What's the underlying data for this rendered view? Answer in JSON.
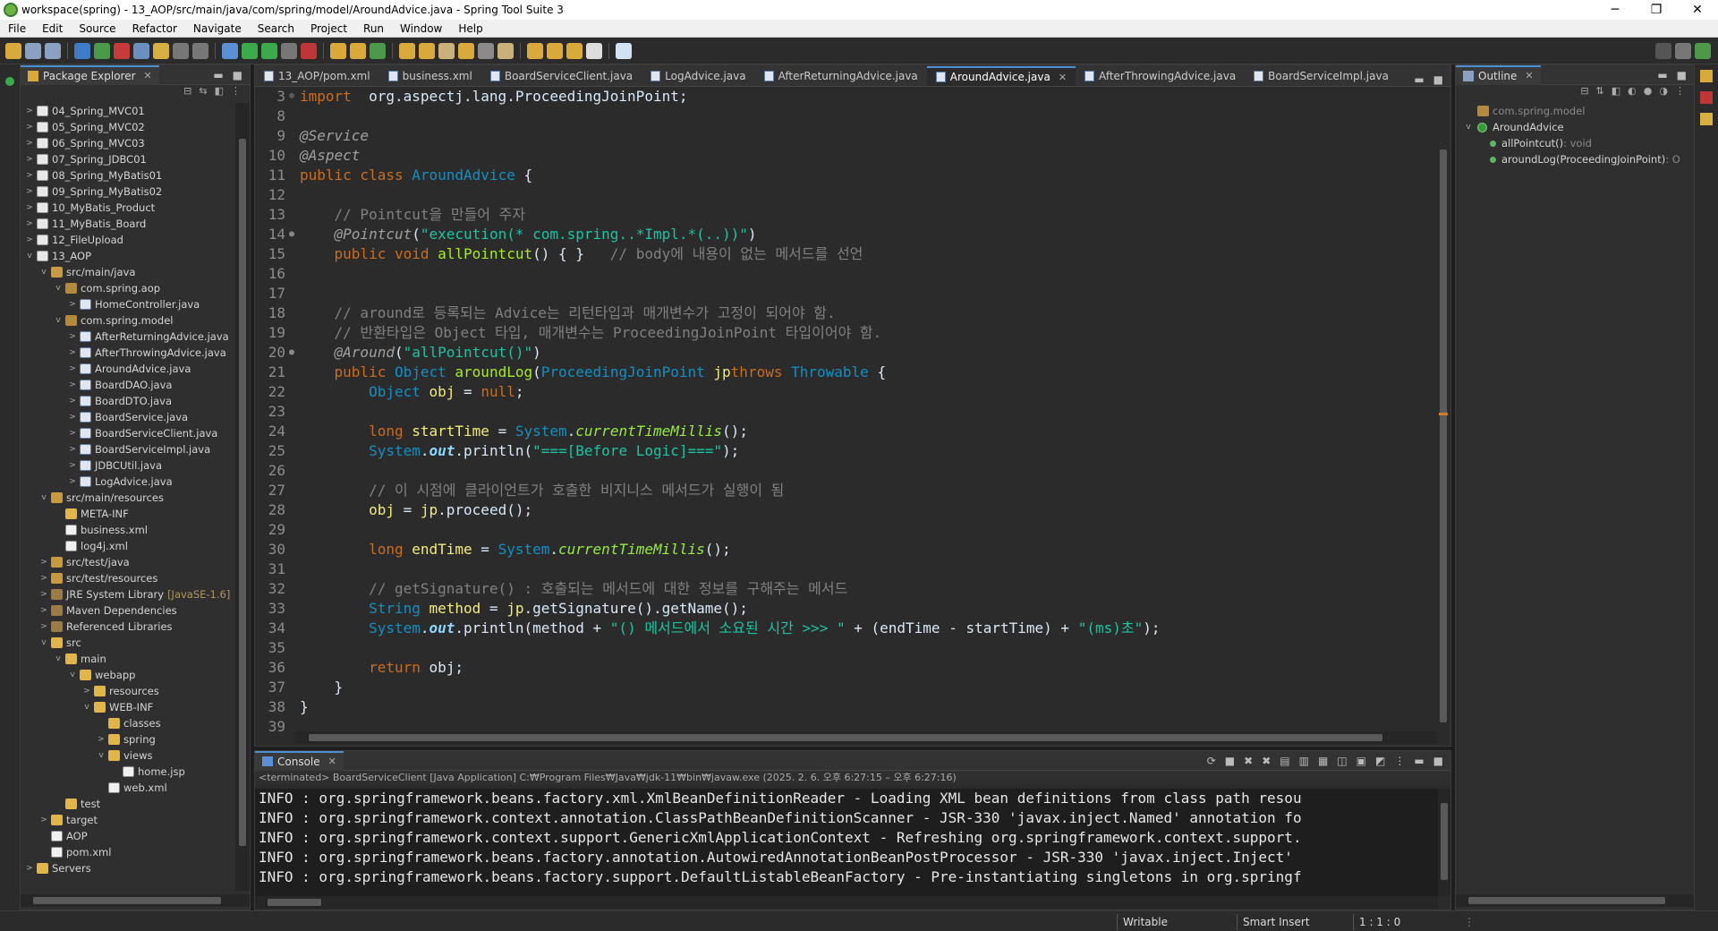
{
  "window": {
    "title": "workspace(spring) - 13_AOP/src/main/java/com/spring/model/AroundAdvice.java - Spring Tool Suite 3",
    "minimize": "─",
    "maximize": "❐",
    "close": "✕"
  },
  "menu": [
    "File",
    "Edit",
    "Source",
    "Refactor",
    "Navigate",
    "Search",
    "Project",
    "Run",
    "Window",
    "Help"
  ],
  "package_explorer": {
    "title": "Package Explorer",
    "tree": [
      {
        "depth": 0,
        "twisty": ">",
        "icon": "proj",
        "label": "04_Spring_MVC01"
      },
      {
        "depth": 0,
        "twisty": ">",
        "icon": "proj",
        "label": "05_Spring_MVC02"
      },
      {
        "depth": 0,
        "twisty": ">",
        "icon": "proj",
        "label": "06_Spring_MVC03"
      },
      {
        "depth": 0,
        "twisty": ">",
        "icon": "proj",
        "label": "07_Spring_JDBC01"
      },
      {
        "depth": 0,
        "twisty": ">",
        "icon": "proj",
        "label": "08_Spring_MyBatis01"
      },
      {
        "depth": 0,
        "twisty": ">",
        "icon": "proj",
        "label": "09_Spring_MyBatis02"
      },
      {
        "depth": 0,
        "twisty": ">",
        "icon": "proj",
        "label": "10_MyBatis_Product"
      },
      {
        "depth": 0,
        "twisty": ">",
        "icon": "proj",
        "label": "11_MyBatis_Board"
      },
      {
        "depth": 0,
        "twisty": ">",
        "icon": "proj",
        "label": "12_FileUpload"
      },
      {
        "depth": 0,
        "twisty": "v",
        "icon": "proj",
        "label": "13_AOP"
      },
      {
        "depth": 1,
        "twisty": "v",
        "icon": "src",
        "label": "src/main/java"
      },
      {
        "depth": 2,
        "twisty": "v",
        "icon": "pkgi",
        "label": "com.spring.aop"
      },
      {
        "depth": 3,
        "twisty": ">",
        "icon": "java",
        "label": "HomeController.java"
      },
      {
        "depth": 2,
        "twisty": "v",
        "icon": "pkgi",
        "label": "com.spring.model"
      },
      {
        "depth": 3,
        "twisty": ">",
        "icon": "java",
        "label": "AfterReturningAdvice.java"
      },
      {
        "depth": 3,
        "twisty": ">",
        "icon": "java",
        "label": "AfterThrowingAdvice.java"
      },
      {
        "depth": 3,
        "twisty": ">",
        "icon": "java",
        "label": "AroundAdvice.java"
      },
      {
        "depth": 3,
        "twisty": ">",
        "icon": "java",
        "label": "BoardDAO.java"
      },
      {
        "depth": 3,
        "twisty": ">",
        "icon": "java",
        "label": "BoardDTO.java"
      },
      {
        "depth": 3,
        "twisty": ">",
        "icon": "java",
        "label": "BoardService.java"
      },
      {
        "depth": 3,
        "twisty": ">",
        "icon": "java",
        "label": "BoardServiceClient.java"
      },
      {
        "depth": 3,
        "twisty": ">",
        "icon": "java",
        "label": "BoardServiceImpl.java"
      },
      {
        "depth": 3,
        "twisty": ">",
        "icon": "java",
        "label": "JDBCUtil.java"
      },
      {
        "depth": 3,
        "twisty": ">",
        "icon": "java",
        "label": "LogAdvice.java"
      },
      {
        "depth": 1,
        "twisty": "v",
        "icon": "src",
        "label": "src/main/resources"
      },
      {
        "depth": 2,
        "twisty": "",
        "icon": "folder",
        "label": "META-INF"
      },
      {
        "depth": 2,
        "twisty": "",
        "icon": "xml",
        "label": "business.xml"
      },
      {
        "depth": 2,
        "twisty": "",
        "icon": "xml",
        "label": "log4j.xml"
      },
      {
        "depth": 1,
        "twisty": ">",
        "icon": "src",
        "label": "src/test/java"
      },
      {
        "depth": 1,
        "twisty": ">",
        "icon": "src",
        "label": "src/test/resources"
      },
      {
        "depth": 1,
        "twisty": ">",
        "icon": "lib",
        "label": "JRE System Library",
        "extra": "[JavaSE-1.6]"
      },
      {
        "depth": 1,
        "twisty": ">",
        "icon": "lib",
        "label": "Maven Dependencies"
      },
      {
        "depth": 1,
        "twisty": ">",
        "icon": "lib",
        "label": "Referenced Libraries"
      },
      {
        "depth": 1,
        "twisty": "v",
        "icon": "folder",
        "label": "src"
      },
      {
        "depth": 2,
        "twisty": "v",
        "icon": "folder",
        "label": "main"
      },
      {
        "depth": 3,
        "twisty": "v",
        "icon": "folder",
        "label": "webapp"
      },
      {
        "depth": 4,
        "twisty": ">",
        "icon": "folder",
        "label": "resources"
      },
      {
        "depth": 4,
        "twisty": "v",
        "icon": "folder",
        "label": "WEB-INF"
      },
      {
        "depth": 5,
        "twisty": "",
        "icon": "folder",
        "label": "classes"
      },
      {
        "depth": 5,
        "twisty": ">",
        "icon": "folder",
        "label": "spring"
      },
      {
        "depth": 5,
        "twisty": "v",
        "icon": "folder",
        "label": "views"
      },
      {
        "depth": 6,
        "twisty": "",
        "icon": "xml",
        "label": "home.jsp"
      },
      {
        "depth": 5,
        "twisty": "",
        "icon": "xml",
        "label": "web.xml"
      },
      {
        "depth": 2,
        "twisty": "",
        "icon": "folder",
        "label": "test"
      },
      {
        "depth": 1,
        "twisty": ">",
        "icon": "folder",
        "label": "target"
      },
      {
        "depth": 1,
        "twisty": "",
        "icon": "xml",
        "label": "AOP"
      },
      {
        "depth": 1,
        "twisty": "",
        "icon": "xml",
        "label": "pom.xml"
      },
      {
        "depth": 0,
        "twisty": ">",
        "icon": "folder",
        "label": "Servers"
      }
    ]
  },
  "editor": {
    "tabs": [
      {
        "label": "13_AOP/pom.xml",
        "active": false
      },
      {
        "label": "business.xml",
        "active": false
      },
      {
        "label": "BoardServiceClient.java",
        "active": false
      },
      {
        "label": "LogAdvice.java",
        "active": false
      },
      {
        "label": "AfterReturningAdvice.java",
        "active": false
      },
      {
        "label": "AroundAdvice.java",
        "active": true
      },
      {
        "label": "AfterThrowingAdvice.java",
        "active": false
      },
      {
        "label": "BoardServiceImpl.java",
        "active": false
      }
    ],
    "lines": [
      {
        "n": "3",
        "m": "⊕",
        "tokens": [
          [
            "k",
            "import"
          ],
          [
            "",
            "  org.aspectj.lang.ProceedingJoinPoint;"
          ]
        ]
      },
      {
        "n": "8",
        "m": "",
        "tokens": []
      },
      {
        "n": "9",
        "m": "",
        "tokens": [
          [
            "ann",
            "@Service"
          ]
        ]
      },
      {
        "n": "10",
        "m": "",
        "tokens": [
          [
            "ann",
            "@Aspect"
          ]
        ]
      },
      {
        "n": "11",
        "m": "",
        "tokens": [
          [
            "k",
            "public class "
          ],
          [
            "t",
            "AroundAdvice"
          ],
          [
            "",
            " {"
          ]
        ]
      },
      {
        "n": "12",
        "m": "",
        "tokens": []
      },
      {
        "n": "13",
        "m": "",
        "tokens": [
          [
            "com",
            "    // Pointcut을 만들어 주자"
          ]
        ]
      },
      {
        "n": "14",
        "m": "●",
        "tokens": [
          [
            "ann",
            "    @Pointcut"
          ],
          [
            "",
            "("
          ],
          [
            "str",
            "\"execution(* com.spring..*Impl.*(..))\""
          ],
          [
            "",
            ")"
          ]
        ]
      },
      {
        "n": "15",
        "m": "",
        "tokens": [
          [
            "k",
            "    public void "
          ],
          [
            "fn",
            "allPointcut"
          ],
          [
            "",
            "() { }   "
          ],
          [
            "com",
            "// body에 내용이 없는 메서드를 선언"
          ]
        ]
      },
      {
        "n": "16",
        "m": "",
        "tokens": []
      },
      {
        "n": "17",
        "m": "",
        "tokens": []
      },
      {
        "n": "18",
        "m": "",
        "tokens": [
          [
            "com",
            "    // around로 등록되는 Advice는 리턴타입과 매개변수가 고정이 되어야 함."
          ]
        ]
      },
      {
        "n": "19",
        "m": "",
        "tokens": [
          [
            "com",
            "    // 반환타입은 Object 타입, 매개변수는 ProceedingJoinPoint 타입이어야 함."
          ]
        ]
      },
      {
        "n": "20",
        "m": "●",
        "tokens": [
          [
            "ann",
            "    @Around"
          ],
          [
            "",
            "("
          ],
          [
            "str",
            "\"allPointcut()\""
          ],
          [
            "",
            ")"
          ]
        ]
      },
      {
        "n": "21",
        "m": "",
        "tokens": [
          [
            "k",
            "    public "
          ],
          [
            "t",
            "Object "
          ],
          [
            "fn",
            "aroundLog"
          ],
          [
            "",
            "("
          ],
          [
            "t",
            "ProceedingJoinPoint "
          ],
          [
            "var",
            "jp"
          ],
          [
            ") "
          ],
          [
            "k",
            "throws "
          ],
          [
            "t",
            "Throwable"
          ],
          [
            "",
            " {"
          ]
        ]
      },
      {
        "n": "22",
        "m": "",
        "tokens": [
          [
            "t",
            "        Object "
          ],
          [
            "var",
            "obj"
          ],
          [
            "",
            " = "
          ],
          [
            "k",
            "null"
          ],
          [
            "",
            ";"
          ]
        ]
      },
      {
        "n": "23",
        "m": "",
        "tokens": []
      },
      {
        "n": "24",
        "m": "",
        "tokens": [
          [
            "k",
            "        long "
          ],
          [
            "var",
            "startTime"
          ],
          [
            "",
            " = "
          ],
          [
            "t",
            "System"
          ],
          [
            "",
            "."
          ],
          [
            "it",
            "currentTimeMillis"
          ],
          [
            "",
            "();"
          ]
        ]
      },
      {
        "n": "25",
        "m": "",
        "tokens": [
          [
            "t",
            "        System"
          ],
          [
            "",
            "."
          ],
          [
            "fld",
            "out"
          ],
          [
            "",
            ".println("
          ],
          [
            "str",
            "\"===[Before Logic]===\""
          ],
          [
            "",
            ");"
          ]
        ]
      },
      {
        "n": "26",
        "m": "",
        "tokens": []
      },
      {
        "n": "27",
        "m": "",
        "tokens": [
          [
            "com",
            "        // 이 시점에 클라이언트가 호출한 비지니스 메서드가 실행이 됨"
          ]
        ]
      },
      {
        "n": "28",
        "m": "",
        "tokens": [
          [
            "var",
            "        obj"
          ],
          [
            "",
            " = "
          ],
          [
            "var",
            "jp"
          ],
          [
            "",
            ".proceed();"
          ]
        ]
      },
      {
        "n": "29",
        "m": "",
        "tokens": []
      },
      {
        "n": "30",
        "m": "",
        "tokens": [
          [
            "k",
            "        long "
          ],
          [
            "var",
            "endTime"
          ],
          [
            "",
            " = "
          ],
          [
            "t",
            "System"
          ],
          [
            "",
            "."
          ],
          [
            "it",
            "currentTimeMillis"
          ],
          [
            "",
            "();"
          ]
        ]
      },
      {
        "n": "31",
        "m": "",
        "tokens": []
      },
      {
        "n": "32",
        "m": "",
        "tokens": [
          [
            "com",
            "        // getSignature() : 호출되는 메서드에 대한 정보를 구해주는 메서드"
          ]
        ]
      },
      {
        "n": "33",
        "m": "",
        "tokens": [
          [
            "t",
            "        String "
          ],
          [
            "var",
            "method"
          ],
          [
            "",
            " = "
          ],
          [
            "var",
            "jp"
          ],
          [
            "",
            ".getSignature().getName();"
          ]
        ]
      },
      {
        "n": "34",
        "m": "",
        "tokens": [
          [
            "t",
            "        System"
          ],
          [
            "",
            "."
          ],
          [
            "fld",
            "out"
          ],
          [
            "",
            ".println(method + "
          ],
          [
            "str",
            "\"() 메서드에서 소요된 시간 >>> \""
          ],
          [
            "",
            " + (endTime - startTime) + "
          ],
          [
            "str",
            "\"(ms)초\""
          ],
          [
            "",
            ");"
          ]
        ]
      },
      {
        "n": "35",
        "m": "",
        "tokens": []
      },
      {
        "n": "36",
        "m": "",
        "tokens": [
          [
            "k",
            "        return "
          ],
          [
            "",
            "obj;"
          ]
        ]
      },
      {
        "n": "37",
        "m": "",
        "tokens": [
          [
            "",
            "    }"
          ]
        ]
      },
      {
        "n": "38",
        "m": "",
        "tokens": [
          [
            "",
            "}"
          ]
        ]
      },
      {
        "n": "39",
        "m": "",
        "tokens": []
      }
    ]
  },
  "console": {
    "title": "Console",
    "status": "<terminated> BoardServiceClient [Java Application] C:₩Program Files₩Java₩jdk-11₩bin₩javaw.exe  (2025. 2. 6. 오후 6:27:15 – 오후 6:27:16)",
    "lines": [
      "INFO : org.springframework.beans.factory.xml.XmlBeanDefinitionReader - Loading XML bean definitions from class path resou",
      "INFO : org.springframework.context.annotation.ClassPathBeanDefinitionScanner - JSR-330 'javax.inject.Named' annotation fo",
      "INFO : org.springframework.context.support.GenericXmlApplicationContext - Refreshing org.springframework.context.support.",
      "INFO : org.springframework.beans.factory.annotation.AutowiredAnnotationBeanPostProcessor - JSR-330 'javax.inject.Inject' ",
      "INFO : org.springframework.beans.factory.support.DefaultListableBeanFactory - Pre-instantiating singletons in org.springf"
    ]
  },
  "outline": {
    "title": "Outline",
    "package": "com.spring.model",
    "class": "AroundAdvice",
    "methods": [
      {
        "name": "allPointcut()",
        "type": " : void"
      },
      {
        "name": "aroundLog(ProceedingJoinPoint)",
        "type": " : O"
      }
    ]
  },
  "status": {
    "writable": "Writable",
    "insert_mode": "Smart Insert",
    "position": "1 : 1 : 0"
  }
}
